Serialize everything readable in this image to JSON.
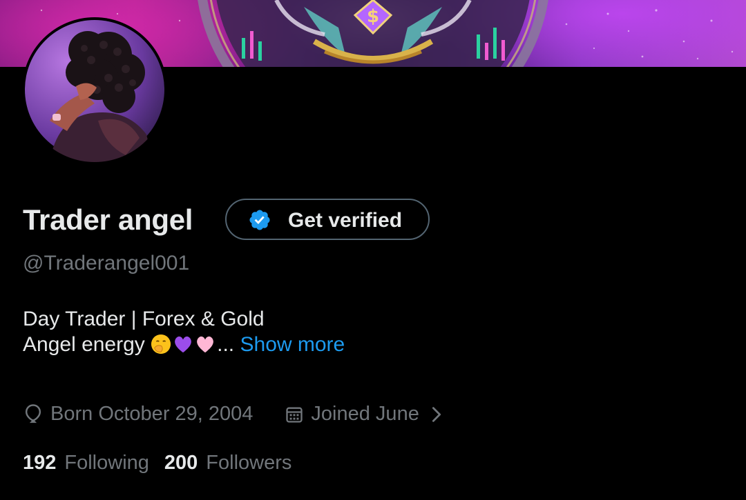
{
  "profile": {
    "display_name": "Trader angel",
    "handle": "@Traderangel001",
    "verify_button_label": "Get verified",
    "bio_line1": "Day Trader | Forex & Gold",
    "bio_line2": "Angel energy",
    "bio_emojis": [
      "face-with-hand-over-mouth",
      "purple-heart",
      "pink-heart"
    ],
    "bio_ellipsis": "...",
    "show_more_label": "Show more",
    "birthday": "Born October 29, 2004",
    "joined": "Joined June",
    "following_count": "192",
    "following_label": "Following",
    "followers_count": "200",
    "followers_label": "Followers"
  },
  "icons": {
    "verified_badge": "verified-badge-icon",
    "birthday": "balloon-icon",
    "joined": "calendar-icon",
    "joined_expand": "chevron-right-icon"
  },
  "colors": {
    "background": "#000000",
    "primary_text": "#e7e9ea",
    "secondary_text": "#71767b",
    "link": "#1d9bf0",
    "button_border": "#536471",
    "verified_blue": "#1d9bf0"
  }
}
